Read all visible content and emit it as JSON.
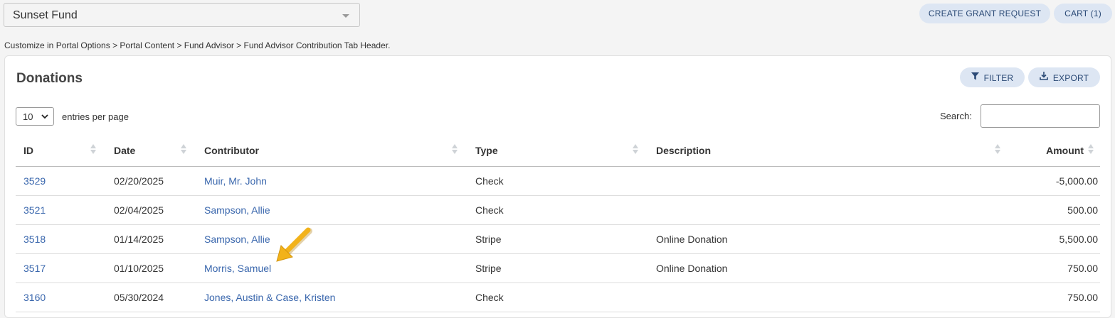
{
  "fund_selector": {
    "value": "Sunset Fund"
  },
  "top_buttons": {
    "create_grant": "CREATE GRANT REQUEST",
    "cart": "CART (1)"
  },
  "breadcrumb": "Customize in Portal Options > Portal Content > Fund Advisor > Fund Advisor Contribution Tab Header.",
  "panel": {
    "title": "Donations",
    "filter_label": "FILTER",
    "export_label": "EXPORT",
    "entries_value": "10",
    "entries_label": "entries per page",
    "search_label": "Search:"
  },
  "table": {
    "columns": [
      "ID",
      "Date",
      "Contributor",
      "Type",
      "Description",
      "Amount"
    ],
    "rows": [
      {
        "id": "3529",
        "date": "02/20/2025",
        "contributor": "Muir, Mr. John",
        "type": "Check",
        "description": "",
        "amount": "-5,000.00"
      },
      {
        "id": "3521",
        "date": "02/04/2025",
        "contributor": "Sampson, Allie",
        "type": "Check",
        "description": "",
        "amount": "500.00"
      },
      {
        "id": "3518",
        "date": "01/14/2025",
        "contributor": "Sampson, Allie",
        "type": "Stripe",
        "description": "Online Donation",
        "amount": "5,500.00"
      },
      {
        "id": "3517",
        "date": "01/10/2025",
        "contributor": "Morris, Samuel",
        "type": "Stripe",
        "description": "Online Donation",
        "amount": "750.00"
      },
      {
        "id": "3160",
        "date": "05/30/2024",
        "contributor": "Jones, Austin & Case, Kristen",
        "type": "Check",
        "description": "",
        "amount": "750.00"
      }
    ]
  },
  "colors": {
    "accent_pill": "#dde6f3",
    "link": "#3a67ad",
    "annotation_arrow": "#f2b21a"
  }
}
